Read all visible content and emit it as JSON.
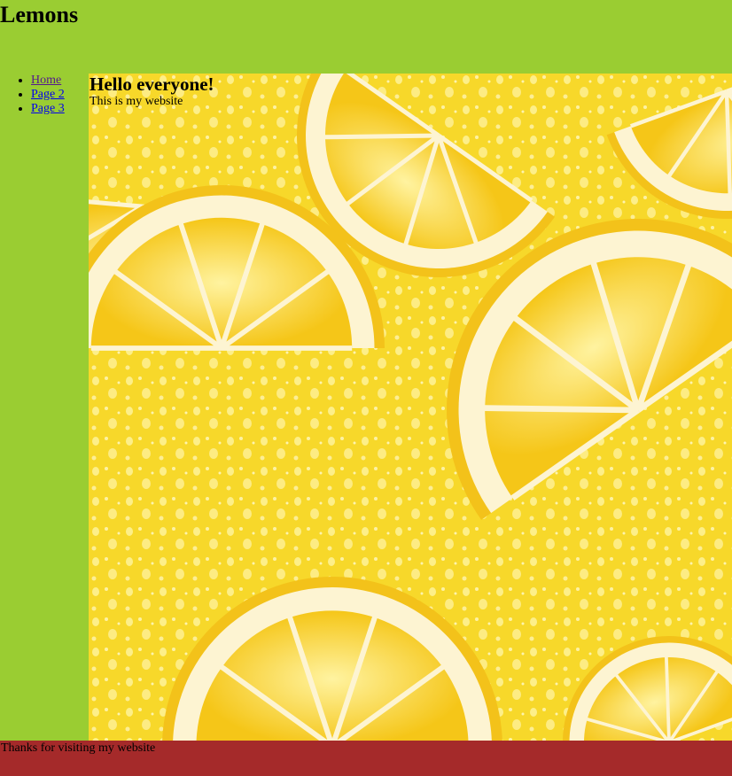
{
  "header": {
    "title": "Lemons"
  },
  "nav": {
    "items": [
      {
        "label": "Home",
        "visited": true
      },
      {
        "label": "Page 2",
        "visited": false
      },
      {
        "label": "Page 3",
        "visited": false
      }
    ]
  },
  "main": {
    "heading": "Hello everyone!",
    "text": "This is my website"
  },
  "footer": {
    "text": "Thanks for visiting my website"
  },
  "colors": {
    "page_bg": "#9acd32",
    "footer_bg": "#a52a2a",
    "lemon_bg": "#f7d82a",
    "link": "#0000ee",
    "link_visited": "#551a8b"
  }
}
